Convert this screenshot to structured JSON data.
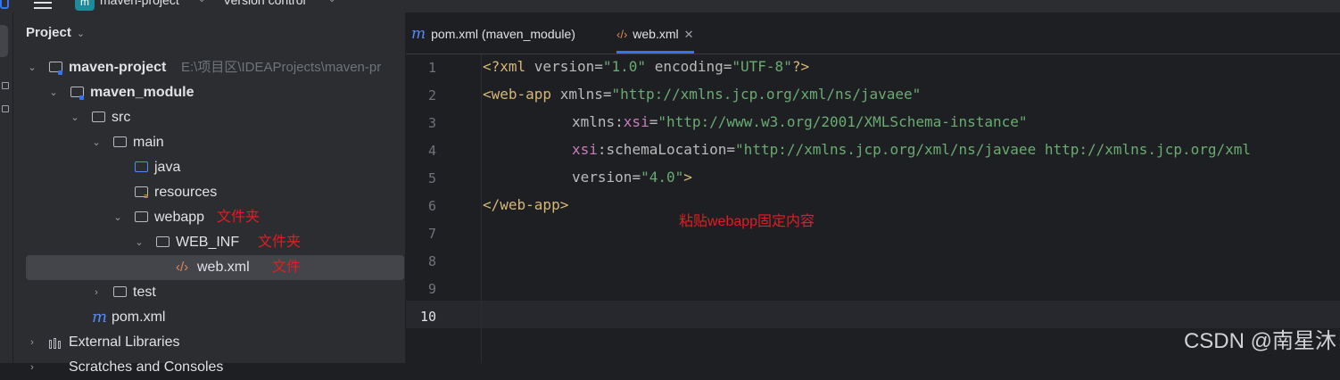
{
  "topbar": {
    "project_badge": "m",
    "project_name": "maven-project",
    "version_control": "Version control"
  },
  "panel": {
    "title": "Project",
    "tree": [
      {
        "label": "maven-project",
        "path": "E:\\项目区\\IDEAProjects\\maven-pr"
      },
      {
        "label": "maven_module"
      },
      {
        "label": "src"
      },
      {
        "label": "main"
      },
      {
        "label": "java"
      },
      {
        "label": "resources"
      },
      {
        "label": "webapp",
        "note": "文件夹"
      },
      {
        "label": "WEB_INF",
        "note": "文件夹"
      },
      {
        "label": "web.xml",
        "note": "文件"
      },
      {
        "label": "test"
      },
      {
        "label": "pom.xml"
      },
      {
        "label": "External Libraries"
      },
      {
        "label": "Scratches and Consoles"
      }
    ]
  },
  "editor": {
    "tabs": [
      {
        "label": "pom.xml (maven_module)"
      },
      {
        "label": "web.xml"
      }
    ],
    "line_numbers": [
      "1",
      "2",
      "3",
      "4",
      "5",
      "6",
      "7",
      "8",
      "9",
      "10"
    ],
    "lines": {
      "l1": {
        "a": "<?xml ",
        "b": "version",
        "c": "=",
        "d": "\"1.0\"",
        "e": " ",
        "f": "encoding",
        "g": "=",
        "h": "\"UTF-8\"",
        "i": "?>"
      },
      "l2": {
        "a": "<web-app ",
        "b": "xmlns",
        "c": "=",
        "d": "\"http://xmlns.jcp.org/xml/ns/javaee\""
      },
      "l3": {
        "a": "xmlns:",
        "b": "xsi",
        "c": "=",
        "d": "\"http://www.w3.org/2001/XMLSchema-instance\""
      },
      "l4": {
        "a": "xsi",
        "b": ":schemaLocation",
        "c": "=",
        "d": "\"http://xmlns.jcp.org/xml/ns/javaee http://xmlns.jcp.org/xml"
      },
      "l5": {
        "a": "version",
        "b": "=",
        "c": "\"4.0\"",
        "d": ">"
      },
      "l6": {
        "a": "</web-app>"
      }
    },
    "annotation": "粘贴webapp固定内容"
  },
  "watermark": "CSDN @南星沐"
}
